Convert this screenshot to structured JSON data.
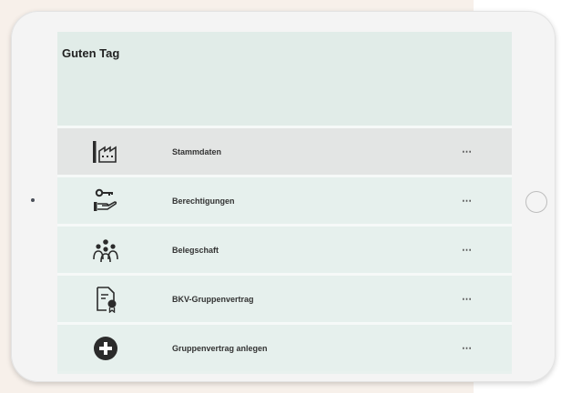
{
  "header": {
    "greeting": "Guten Tag"
  },
  "menu": {
    "items": [
      {
        "label": "Stammdaten",
        "icon": "factory-icon",
        "more": "⋯"
      },
      {
        "label": "Berechtigungen",
        "icon": "key-hand-icon",
        "more": "⋯"
      },
      {
        "label": "Belegschaft",
        "icon": "team-icon",
        "more": "⋯"
      },
      {
        "label": "BKV-Gruppenvertrag",
        "icon": "contract-icon",
        "more": "⋯"
      },
      {
        "label": "Gruppenvertrag anlegen",
        "icon": "add-circle-icon",
        "more": "⋯"
      }
    ]
  },
  "colors": {
    "screen_background": "#e8f1ee",
    "selected_row": "#e3e5e4",
    "icon_dark": "#2b2b2b"
  }
}
